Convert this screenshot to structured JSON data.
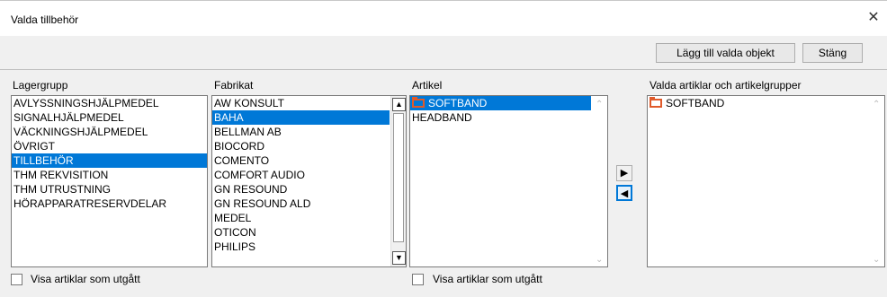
{
  "window": {
    "title": "Valda tillbehör"
  },
  "toolbar": {
    "add_label": "Lägg till valda objekt",
    "close_label": "Stäng"
  },
  "columns": {
    "lagergrupp": {
      "header": "Lagergrupp",
      "items": [
        "AVLYSSNINGSHJÄLPMEDEL",
        "SIGNALHJÄLPMEDEL",
        "VÄCKNINGSHJÄLPMEDEL",
        "ÖVRIGT",
        "TILLBEHÖR",
        "THM REKVISITION",
        "THM UTRUSTNING",
        "HÖRAPPARATRESERVDELAR"
      ],
      "selected": 4
    },
    "fabrikat": {
      "header": "Fabrikat",
      "items": [
        "AW KONSULT",
        "BAHA",
        "BELLMAN AB",
        "BIOCORD",
        "COMENTO",
        "COMFORT AUDIO",
        "GN RESOUND",
        "GN RESOUND ALD",
        "MEDEL",
        "OTICON",
        "PHILIPS"
      ],
      "selected": 1
    },
    "artikel": {
      "header": "Artikel",
      "items": [
        {
          "label": "SOFTBAND",
          "folder": true
        },
        {
          "label": "HEADBAND",
          "folder": false
        }
      ],
      "selected": 0
    },
    "valda": {
      "header": "Valda artiklar och artikelgrupper",
      "items": [
        {
          "label": "SOFTBAND",
          "folder": true
        }
      ]
    }
  },
  "checkboxes": {
    "left": {
      "label": "Visa artiklar som utgått",
      "checked": false
    },
    "middle": {
      "label": "Visa artiklar som utgått",
      "checked": false
    }
  },
  "colors": {
    "selection": "#0078d7",
    "folder": "#e05a2a"
  }
}
